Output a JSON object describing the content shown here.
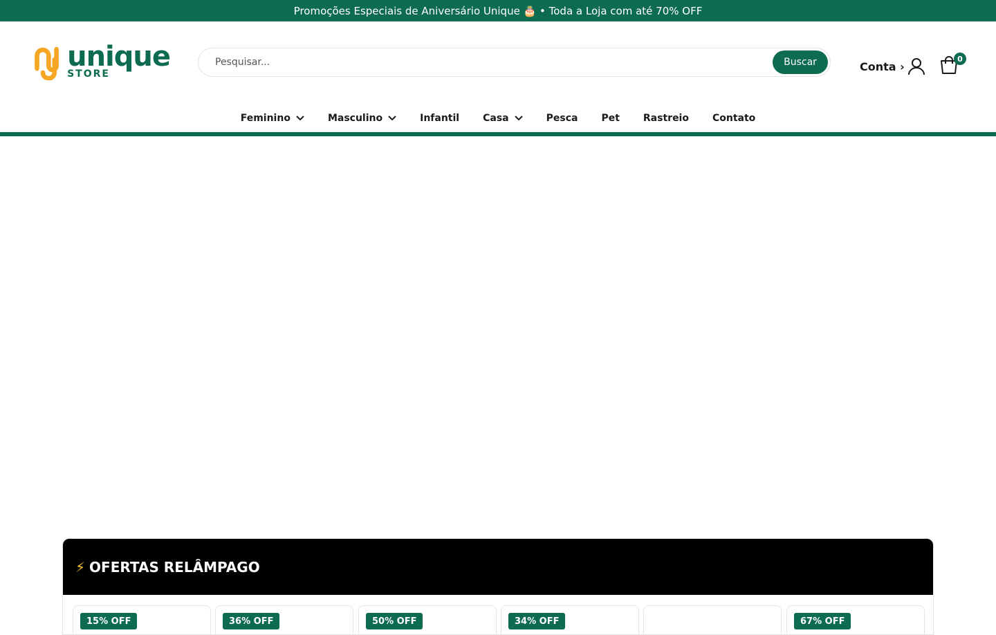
{
  "announcement": "Promoções Especiais de Aniversário Unique 🎂 • Toda a Loja com até 70% OFF",
  "logo": {
    "word": "unique",
    "sub": "STORE"
  },
  "search": {
    "placeholder": "Pesquisar...",
    "button": "Buscar"
  },
  "account": {
    "label": "Conta ›"
  },
  "cart": {
    "count": "0"
  },
  "nav": {
    "items": [
      {
        "label": "Feminino",
        "dropdown": true
      },
      {
        "label": "Masculino",
        "dropdown": true
      },
      {
        "label": "Infantil",
        "dropdown": false
      },
      {
        "label": "Casa",
        "dropdown": true
      },
      {
        "label": "Pesca",
        "dropdown": false
      },
      {
        "label": "Pet",
        "dropdown": false
      },
      {
        "label": "Rastreio",
        "dropdown": false
      },
      {
        "label": "Contato",
        "dropdown": false
      }
    ]
  },
  "flash": {
    "bolt": "⚡",
    "title": "OFERTAS RELÂMPAGO",
    "badges": [
      "15% OFF",
      "36% OFF",
      "50% OFF",
      "34% OFF",
      "",
      "67% OFF"
    ]
  },
  "colors": {
    "brand": "#0c6b50",
    "accent": "#f5a623"
  }
}
